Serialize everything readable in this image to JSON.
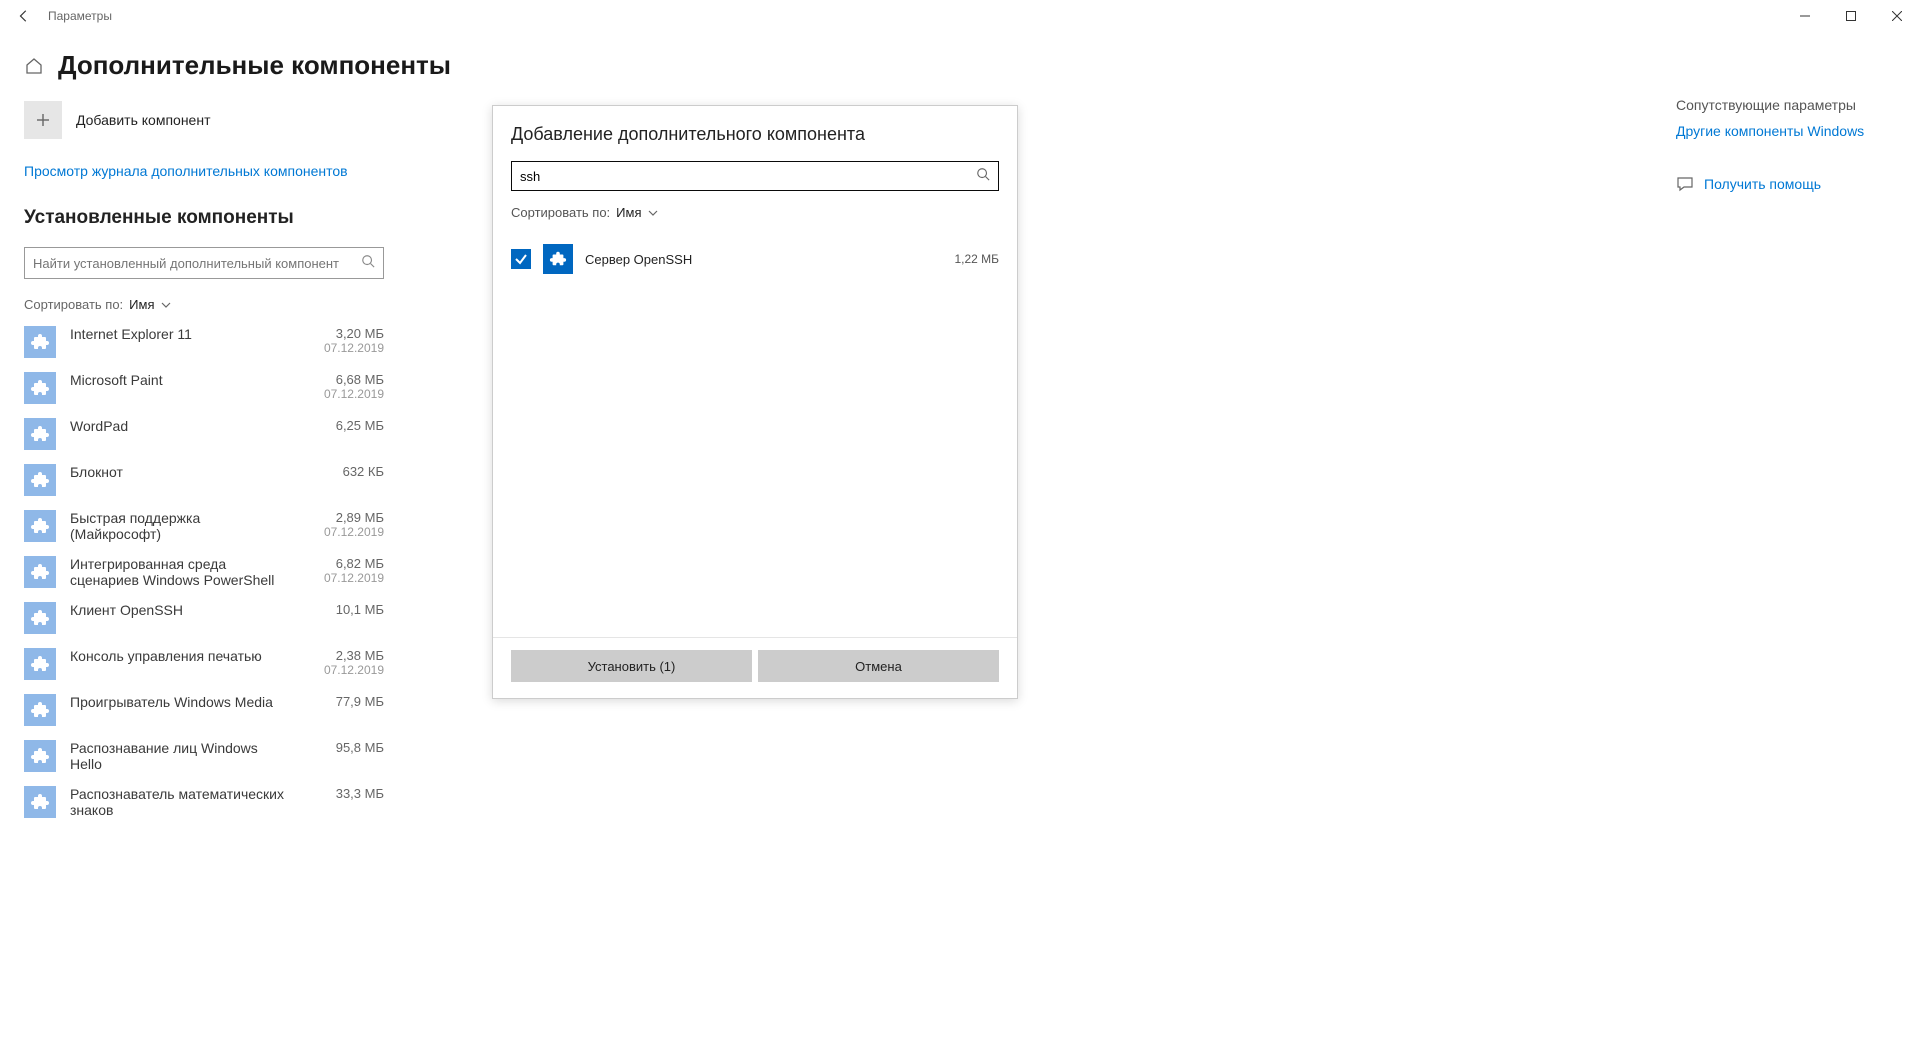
{
  "window": {
    "title": "Параметры"
  },
  "page": {
    "title": "Дополнительные компоненты",
    "add_label": "Добавить компонент",
    "history_link": "Просмотр журнала дополнительных компонентов",
    "installed_heading": "Установленные компоненты",
    "search_placeholder": "Найти установленный дополнительный компонент",
    "sort_prefix": "Сортировать по:",
    "sort_value": "Имя"
  },
  "installed": [
    {
      "name": "Internet Explorer 11",
      "size": "3,20 МБ",
      "date": "07.12.2019"
    },
    {
      "name": "Microsoft Paint",
      "size": "6,68 МБ",
      "date": "07.12.2019"
    },
    {
      "name": "WordPad",
      "size": "6,25 МБ",
      "date": ""
    },
    {
      "name": "Блокнот",
      "size": "632 КБ",
      "date": ""
    },
    {
      "name": "Быстрая поддержка (Майкрософт)",
      "size": "2,89 МБ",
      "date": "07.12.2019"
    },
    {
      "name": "Интегрированная среда сценариев Windows PowerShell",
      "size": "6,82 МБ",
      "date": "07.12.2019"
    },
    {
      "name": "Клиент OpenSSH",
      "size": "10,1 МБ",
      "date": ""
    },
    {
      "name": "Консоль управления печатью",
      "size": "2,38 МБ",
      "date": "07.12.2019"
    },
    {
      "name": "Проигрыватель Windows Media",
      "size": "77,9 МБ",
      "date": ""
    },
    {
      "name": "Распознавание лиц Windows Hello",
      "size": "95,8 МБ",
      "date": ""
    },
    {
      "name": "Распознаватель математических знаков",
      "size": "33,3 МБ",
      "date": ""
    }
  ],
  "dialog": {
    "title": "Добавление дополнительного компонента",
    "search_value": "ssh",
    "sort_prefix": "Сортировать по:",
    "sort_value": "Имя",
    "items": [
      {
        "name": "Сервер OpenSSH",
        "size": "1,22 МБ",
        "checked": true
      }
    ],
    "install_label": "Установить (1)",
    "cancel_label": "Отмена"
  },
  "sidebar": {
    "related_heading": "Сопутствующие параметры",
    "related_link": "Другие компоненты Windows",
    "help_label": "Получить помощь"
  }
}
